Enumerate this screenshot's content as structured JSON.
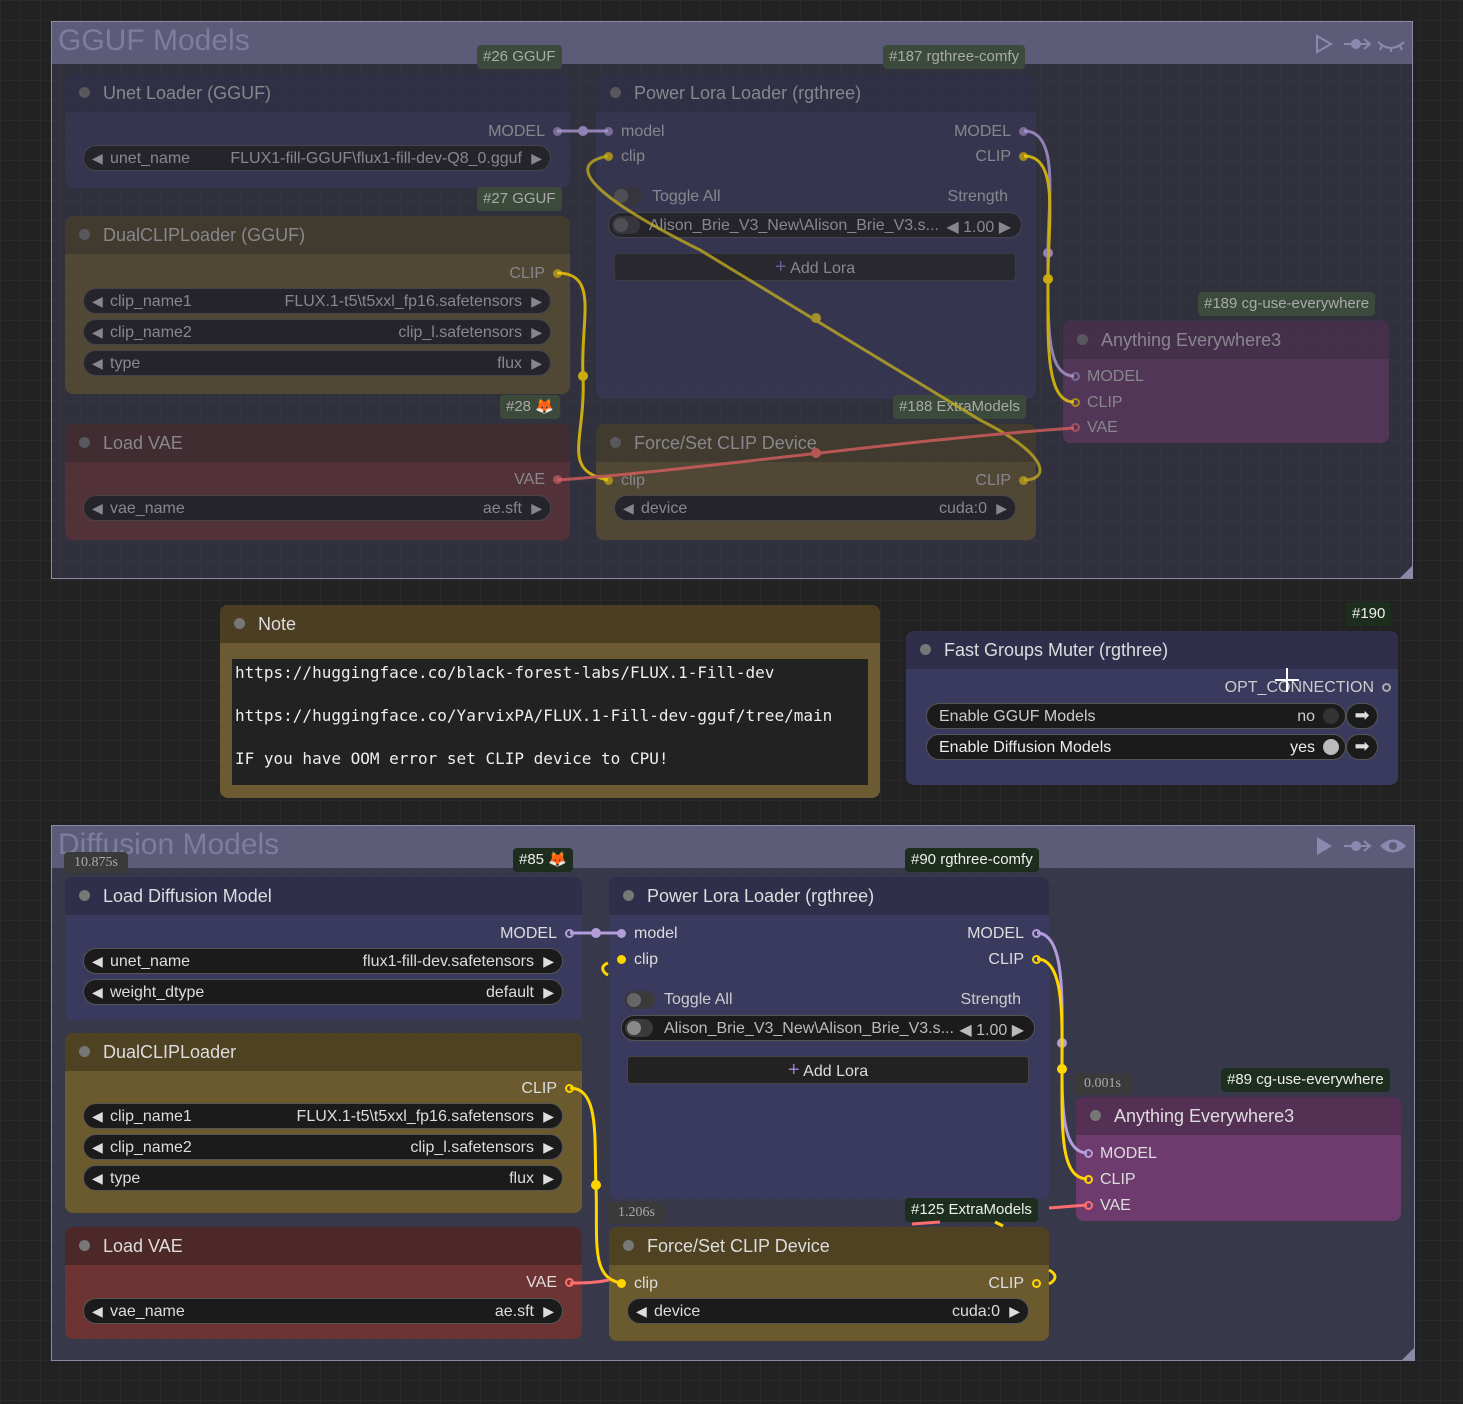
{
  "groups": {
    "gguf": {
      "title": "GGUF Models"
    },
    "diffusion": {
      "title": "Diffusion Models"
    }
  },
  "icons": {
    "play": "play-icon",
    "bypass": "bypass-icon",
    "eye": "eye-icon",
    "eye_closed": "eye-closed-icon"
  },
  "gguf": {
    "unet": {
      "badge": "#26 GGUF",
      "title": "Unet Loader (GGUF)",
      "out_model": "MODEL",
      "w_name": "unet_name",
      "w_value": "FLUX1-fill-GGUF\\flux1-fill-dev-Q8_0.gguf"
    },
    "dualclip": {
      "badge": "#27 GGUF",
      "title": "DualCLIPLoader (GGUF)",
      "out_clip": "CLIP",
      "widgets": [
        {
          "name": "clip_name1",
          "value": "FLUX.1-t5\\t5xxl_fp16.safetensors"
        },
        {
          "name": "clip_name2",
          "value": "clip_l.safetensors"
        },
        {
          "name": "type",
          "value": "flux"
        }
      ]
    },
    "vae": {
      "badge": "#28",
      "title": "Load VAE",
      "out_vae": "VAE",
      "w_name": "vae_name",
      "w_value": "ae.sft"
    },
    "lora": {
      "badge": "#187 rgthree-comfy",
      "title": "Power Lora Loader (rgthree)",
      "in_model": "model",
      "in_clip": "clip",
      "out_model": "MODEL",
      "out_clip": "CLIP",
      "toggle_all": "Toggle All",
      "strength": "Strength",
      "lora_name": "Alison_Brie_V3_New\\Alison_Brie_V3.s...",
      "lora_strength": "1.00",
      "add_lora": "Add Lora"
    },
    "force": {
      "badge": "#188 ExtraModels",
      "title": "Force/Set CLIP Device",
      "in_clip": "clip",
      "out_clip": "CLIP",
      "w_name": "device",
      "w_value": "cuda:0"
    },
    "anything": {
      "badge": "#189 cg-use-everywhere",
      "title": "Anything Everywhere3",
      "in_model": "MODEL",
      "in_clip": "CLIP",
      "in_vae": "VAE"
    }
  },
  "note": {
    "title": "Note",
    "lines": [
      "https://huggingface.co/black-forest-labs/FLUX.1-Fill-dev",
      "https://huggingface.co/YarvixPA/FLUX.1-Fill-dev-gguf/tree/main",
      "IF you have OOM error set CLIP device to CPU!"
    ]
  },
  "muter": {
    "badge": "#190",
    "title": "Fast Groups Muter (rgthree)",
    "out": "OPT_CONNECTION",
    "rows": [
      {
        "label": "Enable GGUF Models",
        "state": "no"
      },
      {
        "label": "Enable Diffusion Models",
        "state": "yes"
      }
    ]
  },
  "diff": {
    "unet": {
      "badge": "#85",
      "time": "10.875s",
      "title": "Load Diffusion Model",
      "out_model": "MODEL",
      "widgets": [
        {
          "name": "unet_name",
          "value": "flux1-fill-dev.safetensors"
        },
        {
          "name": "weight_dtype",
          "value": "default"
        }
      ]
    },
    "dualclip": {
      "title": "DualCLIPLoader",
      "out_clip": "CLIP",
      "widgets": [
        {
          "name": "clip_name1",
          "value": "FLUX.1-t5\\t5xxl_fp16.safetensors"
        },
        {
          "name": "clip_name2",
          "value": "clip_l.safetensors"
        },
        {
          "name": "type",
          "value": "flux"
        }
      ]
    },
    "vae": {
      "title": "Load VAE",
      "out_vae": "VAE",
      "w_name": "vae_name",
      "w_value": "ae.sft"
    },
    "lora": {
      "badge": "#90 rgthree-comfy",
      "time": "1.206s",
      "title": "Power Lora Loader (rgthree)",
      "in_model": "model",
      "in_clip": "clip",
      "out_model": "MODEL",
      "out_clip": "CLIP",
      "toggle_all": "Toggle All",
      "strength": "Strength",
      "lora_name": "Alison_Brie_V3_New\\Alison_Brie_V3.s...",
      "lora_strength": "1.00",
      "add_lora": "Add Lora"
    },
    "force": {
      "badge": "#125 ExtraModels",
      "title": "Force/Set CLIP Device",
      "in_clip": "clip",
      "out_clip": "CLIP",
      "w_name": "device",
      "w_value": "cuda:0"
    },
    "anything": {
      "badge": "#89 cg-use-everywhere",
      "time": "0.001s",
      "title": "Anything Everywhere3",
      "in_model": "MODEL",
      "in_clip": "CLIP",
      "in_vae": "VAE"
    }
  },
  "colors": {
    "model": "#b39ddb",
    "clip": "#ffd500",
    "vae": "#ff6e6e",
    "group": "#5c5c78"
  }
}
